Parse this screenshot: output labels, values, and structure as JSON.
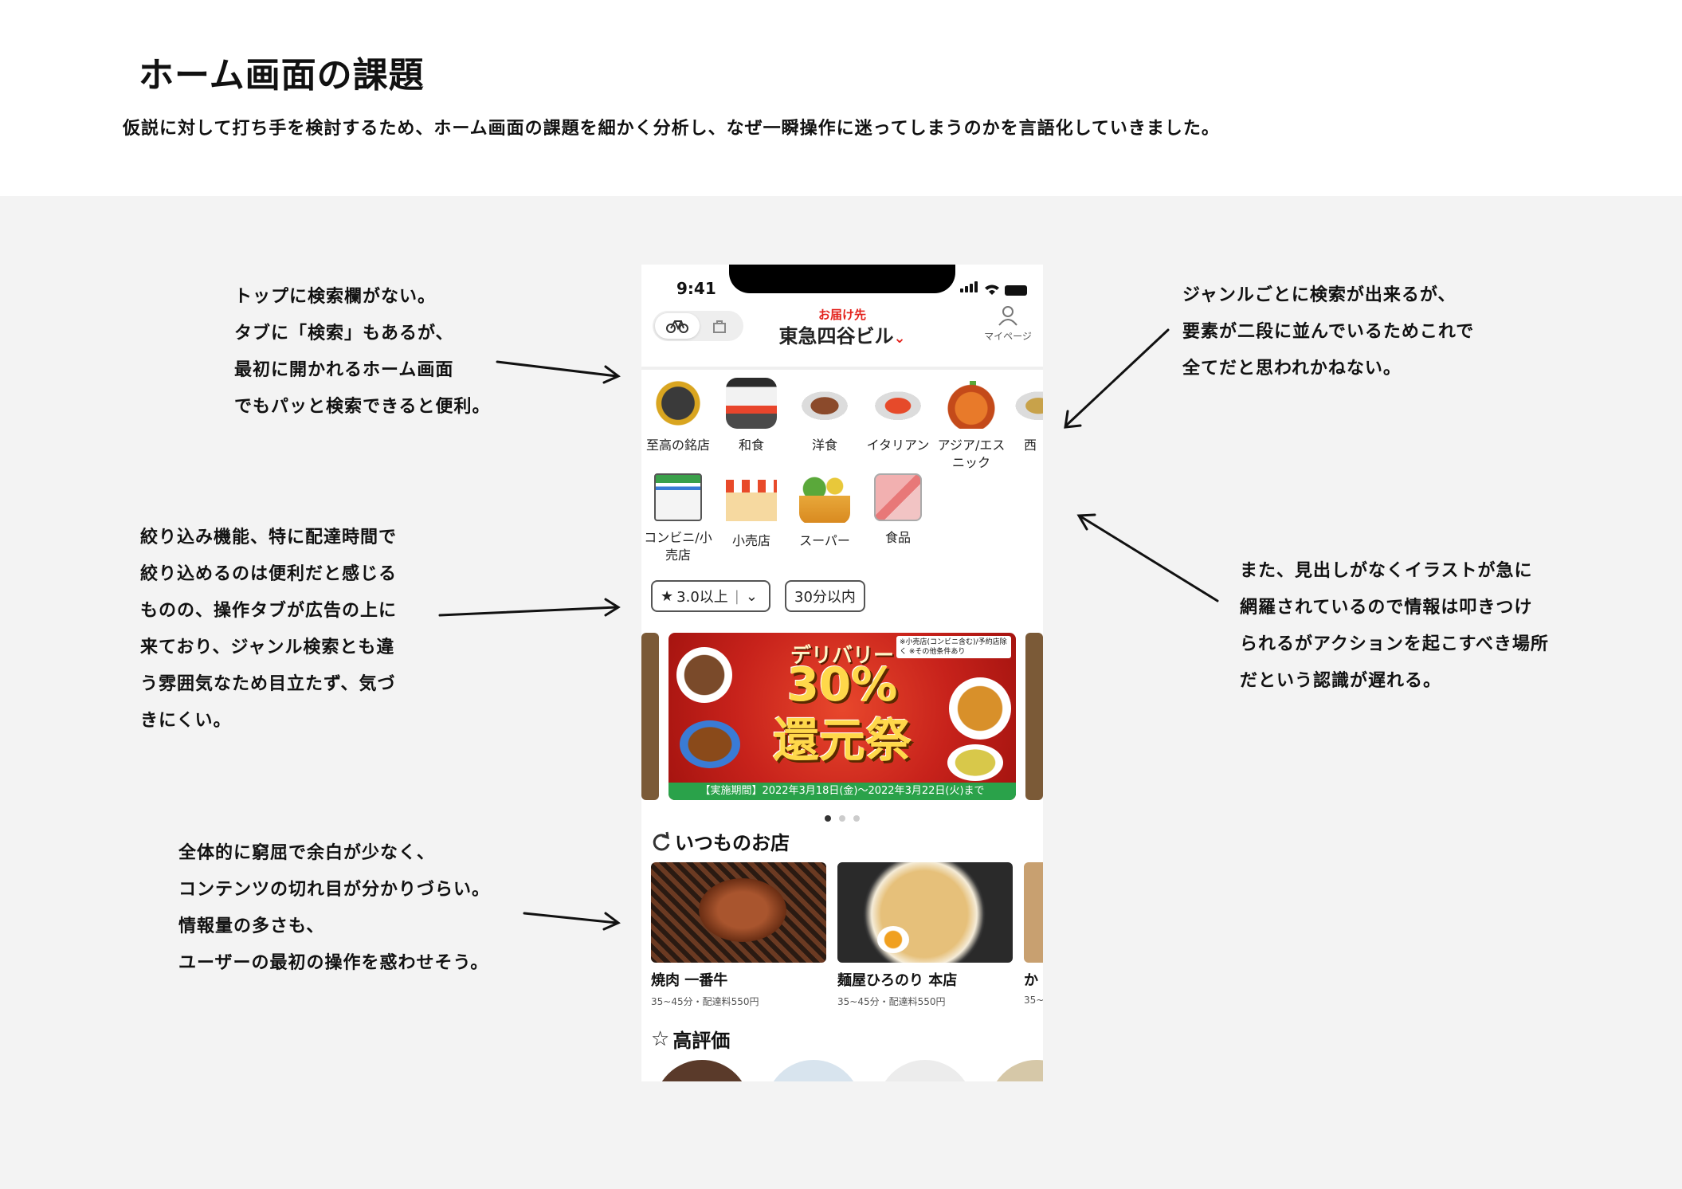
{
  "page": {
    "title": "ホーム画面の課題",
    "subtitle": "仮説に対して打ち手を検討するため、ホーム画面の課題を細かく分析し、なぜ一瞬操作に迷ってしまうのかを言語化していきました。"
  },
  "notes": [
    {
      "lines": [
        "トップに検索欄がない。",
        "タブに「検索」もあるが、",
        "最初に開かれるホーム画面",
        "でもパッと検索できると便利。"
      ]
    },
    {
      "lines": [
        "絞り込み機能、特に配達時間で",
        "絞り込めるのは便利だと感じる",
        "ものの、操作タブが広告の上に",
        "来ており、ジャンル検索とも違",
        "う雰囲気なため目立たず、気づ",
        "きにくい。"
      ]
    },
    {
      "lines": [
        "全体的に窮屈で余白が少なく、",
        "コンテンツの切れ目が分かりづらい。",
        "情報量の多さも、",
        "ユーザーの最初の操作を惑わせそう。"
      ]
    },
    {
      "lines": [
        "ジャンルごとに検索が出来るが、",
        "要素が二段に並んでいるためこれで",
        "全てだと思われかねない。"
      ]
    },
    {
      "lines": [
        "また、見出しがなくイラストが急に",
        "網羅されているので情報は叩きつけ",
        "られるがアクションを起こすべき場所",
        "だという認識が遅れる。"
      ]
    }
  ],
  "phone": {
    "time": "9:41",
    "delivery_label": "お届け先",
    "delivery_address": "東急四谷ビル",
    "mypage": "マイページ",
    "categories_row1": [
      {
        "label": "至高の銘店",
        "icon": "premium-shop-icon"
      },
      {
        "label": "和食",
        "icon": "bento-icon"
      },
      {
        "label": "洋食",
        "icon": "steak-icon"
      },
      {
        "label": "イタリアン",
        "icon": "pasta-icon"
      },
      {
        "label": "アジア/エスニック",
        "icon": "asian-curry-icon"
      },
      {
        "label": "西",
        "icon": "western-food-icon"
      }
    ],
    "categories_row2": [
      {
        "label": "コンビニ/小売店",
        "icon": "convenience-store-icon"
      },
      {
        "label": "小売店",
        "icon": "retail-shop-icon"
      },
      {
        "label": "スーパー",
        "icon": "grocery-basket-icon"
      },
      {
        "label": "食品",
        "icon": "food-pack-icon"
      }
    ],
    "filters": {
      "rating": "3.0以上",
      "time": "30分以内"
    },
    "banner": {
      "top": "デリバリー",
      "big1": "30%",
      "big2": "還元祭",
      "note": "※小売店(コンビニ含む)/予約店除く ※その他条件あり",
      "footer": "【実施期間】2022年3月18日(金)〜2022年3月22日(火)まで"
    },
    "section_regular": "いつものお店",
    "shops": [
      {
        "name": "焼肉 一番牛",
        "meta": "35~45分・配達料550円"
      },
      {
        "name": "麺屋ひろのり 本店",
        "meta": "35~45分・配達料550円"
      },
      {
        "name": "か",
        "meta": "35~"
      }
    ],
    "section_rated": "高評価"
  },
  "colors": {
    "accent": "#e3211b",
    "background_gray": "#f3f3f3"
  }
}
